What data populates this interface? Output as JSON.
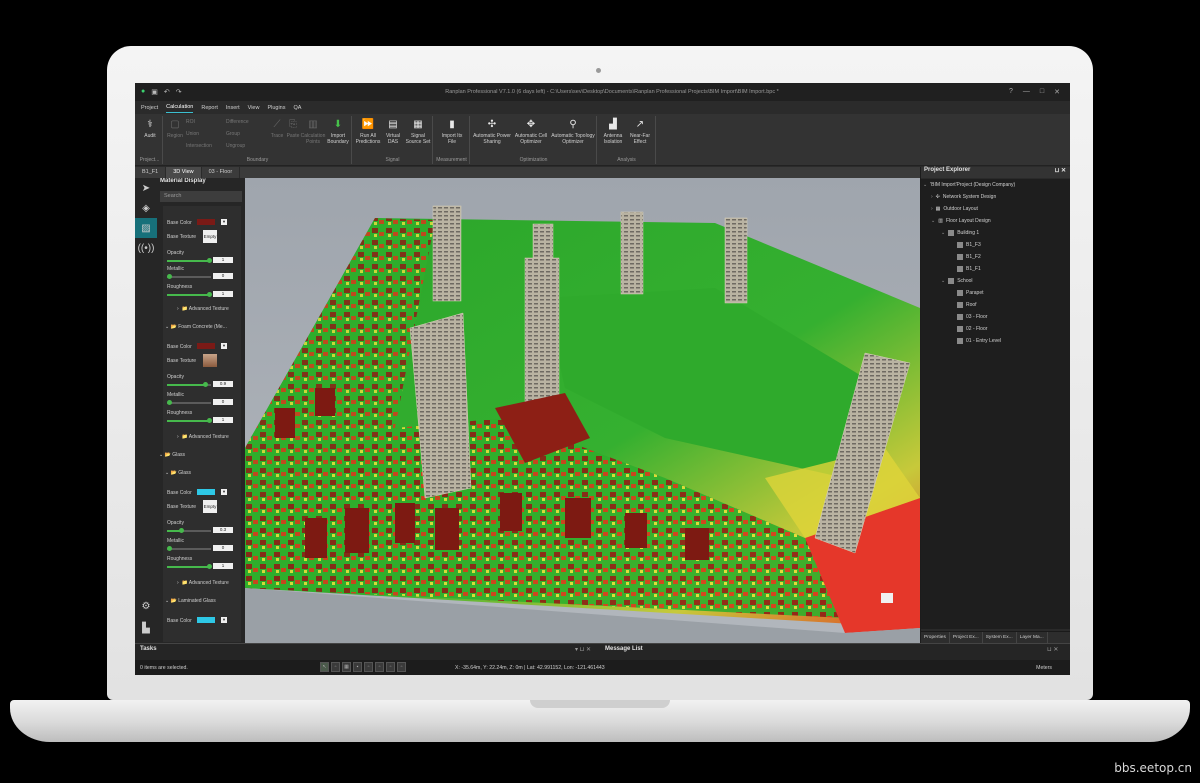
{
  "titlebar": {
    "title": "Ranplan Professional V7.1.0 (6 days left) - C:\\Users\\sev\\Desktop\\Documents\\Ranplan Professional Projects\\BIM Import\\BIM Import.bpc *"
  },
  "menu": [
    "Project",
    "Calculation",
    "Report",
    "Insert",
    "View",
    "Plugins",
    "QA"
  ],
  "ribbon": {
    "project_group": {
      "audit": "Audit",
      "label": "Project..."
    },
    "boundary_group": {
      "label": "Boundary",
      "region": "Region",
      "roi": "ROI",
      "union": "Union",
      "intersection": "Intersection",
      "difference": "Difference",
      "group": "Group",
      "ungroup": "Ungroup",
      "trace": "Trace",
      "paste": "Paste",
      "calc_points": "Calculation Points",
      "import_boundary": "Import Boundary"
    },
    "signal_group": {
      "label": "Signal",
      "run_all": "Run All Predictions",
      "virtual_das": "Virtual DAS",
      "signal_source_set": "Signal Source Set"
    },
    "measurement_group": {
      "label": "Measurement",
      "import_itx": "Import Itx File"
    },
    "optimization_group": {
      "label": "Optimization",
      "auto_power": "Automatic Power Sharing",
      "auto_cell": "Automatic Cell Optimizer",
      "auto_topology": "Automatic Topology Optimizer"
    },
    "analysis_group": {
      "label": "Analysis",
      "antenna_isolation": "Antenna Isolation",
      "near_far": "Near-Far Effect"
    }
  },
  "doc_tabs": [
    "B1_F1",
    "3D View",
    "03 - Floor"
  ],
  "material_panel": {
    "title": "Material Display",
    "search_placeholder": "Search",
    "labels": {
      "base_color": "Base Color",
      "base_texture": "Base Texture",
      "opacity": "Opacity",
      "metallic": "Metallic",
      "roughness": "Roughness",
      "advanced": "Advanced Texture",
      "empty": "Empty"
    },
    "section1": {
      "opacity": "1",
      "metallic": "0",
      "roughness": "1",
      "base_color": "#7a1a16"
    },
    "foam_concrete": {
      "name": "Foam Concrete (Me...",
      "opacity": "0.9",
      "metallic": "0",
      "roughness": "1",
      "base_color": "#7a1a16"
    },
    "glass_group": "Glass",
    "glass": {
      "name": "Glass",
      "opacity": "0.3",
      "metallic": "0",
      "roughness": "1",
      "base_color": "#2ec8e6"
    },
    "laminated": {
      "name": "Laminated Glass",
      "base_color": "#2ec8e6"
    }
  },
  "explorer": {
    "title": "Project Explorer",
    "tree": [
      "'BIM Import'Project (Design Company)",
      "Network System Design",
      "Outdoor Layout",
      "Floor Layout Design",
      "Building 1",
      "B1_F3",
      "B1_F2",
      "B1_F1",
      "School",
      "Parapet",
      "Roof",
      "03 - Floor",
      "02 - Floor",
      "01 - Entry Level"
    ],
    "tabs": [
      "Properties",
      "Project Ex...",
      "System Ex...",
      "Layer Ma..."
    ]
  },
  "bottom": {
    "tasks": "Tasks",
    "messages": "Message List"
  },
  "status": {
    "selected": "0 items are selected.",
    "coords": "X: -35.64m, Y: 22.24m, Z: 0m | Lat: 42.991152, Lon: -121.461443",
    "units": "Meters"
  },
  "watermark": "bbs.eetop.cn",
  "colors": {
    "accent": "#3bbfd0",
    "heat_high": "#d42a1f",
    "heat_mid": "#e8e23a",
    "heat_low": "#2ea82b"
  }
}
